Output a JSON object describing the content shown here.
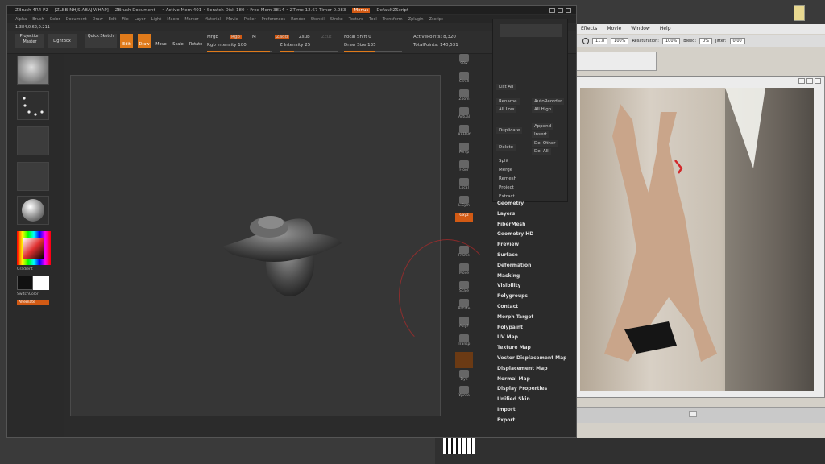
{
  "zbrush": {
    "title_app": "ZBrush 4R4 P2",
    "title_id": "[ZLBB-NHJS-ABAJ-WHAP]",
    "title_doc": "ZBrush Document",
    "title_mem": "• Active Mem 401 • Scratch Disk 180 • Free Mem 3814 • ZTime 12.67 Timer 0.083",
    "menus_btn": "Menus",
    "script_label": "DefaultZScript",
    "menu_items": [
      "Alpha",
      "Brush",
      "Color",
      "Document",
      "Draw",
      "Edit",
      "File",
      "Layer",
      "Light",
      "Macro",
      "Marker",
      "Material",
      "Movie",
      "Picker",
      "Preferences",
      "Render",
      "Stencil",
      "Stroke",
      "Texture",
      "Tool",
      "Transform",
      "Zplugin",
      "Zscript"
    ],
    "status_readout": "1.384,0.62,0.211",
    "top": {
      "projection": "Projection Master",
      "lightbox": "LightBox",
      "quicksketch": "Quick Sketch",
      "edit": "Edit",
      "draw": "Draw",
      "move": "Move",
      "scale": "Scale",
      "rotate": "Rotate",
      "mrgb": "Mrgb",
      "rgb": "Rgb",
      "m": "M",
      "rgb_intensity": "Rgb Intensity 100",
      "zadd": "Zadd",
      "zsub": "Zsub",
      "zcut": "Zcut",
      "z_intensity": "Z Intensity 25",
      "focal_shift": "Focal Shift 0",
      "draw_size": "Draw Size 135",
      "active_points": "ActivePoints: 8,320",
      "total_points": "TotalPoints: 140,531"
    },
    "left": {
      "gradient": "Gradient",
      "switchcolor": "SwitchColor",
      "alternate": "Alternate"
    },
    "right_shelf": [
      "SPix",
      "Scroll",
      "Zoom",
      "Actual",
      "AAHalf",
      "Persp",
      "Floor",
      "Local",
      "L.Sym",
      "Gxyz",
      "",
      "Frame",
      "Move",
      "Scale",
      "Rotate",
      "PolyF",
      "Transp",
      "",
      "Dyn",
      "Xpose"
    ],
    "tool_panel": {
      "list_all": "List All",
      "rename": "Rename",
      "autoreorder": "AutoReorder",
      "all_low": "All Low",
      "all_high": "All High",
      "duplicate": "Duplicate",
      "append": "Append",
      "insert": "Insert",
      "delete": "Delete",
      "del_other": "Del Other",
      "del_all": "Del All",
      "split": "Split",
      "merge": "Merge",
      "remesh": "Remesh",
      "project": "Project",
      "extract": "Extract"
    },
    "subpalettes": [
      "Geometry",
      "Layers",
      "FiberMesh",
      "Geometry HD",
      "Preview",
      "Surface",
      "Deformation",
      "Masking",
      "Visibility",
      "Polygroups",
      "Contact",
      "Morph Target",
      "Polypaint",
      "UV Map",
      "Texture Map",
      "Vector Displacement Map",
      "Displacement Map",
      "Normal Map",
      "Display Properties",
      "Unified Skin",
      "Import",
      "Export"
    ]
  },
  "photo_app": {
    "menus": [
      "Effects",
      "Movie",
      "Window",
      "Help"
    ],
    "brush_size": "11.8",
    "opacity": "100%",
    "resaturation_label": "Resaturation:",
    "resaturation": "100%",
    "bleed_label": "Bleed:",
    "bleed": "0%",
    "jitter_label": "Jitter:",
    "jitter": "0.00"
  },
  "colors": {
    "accent": "#e07a1a",
    "background": "#2b2b2b",
    "canvas": "#363636"
  }
}
